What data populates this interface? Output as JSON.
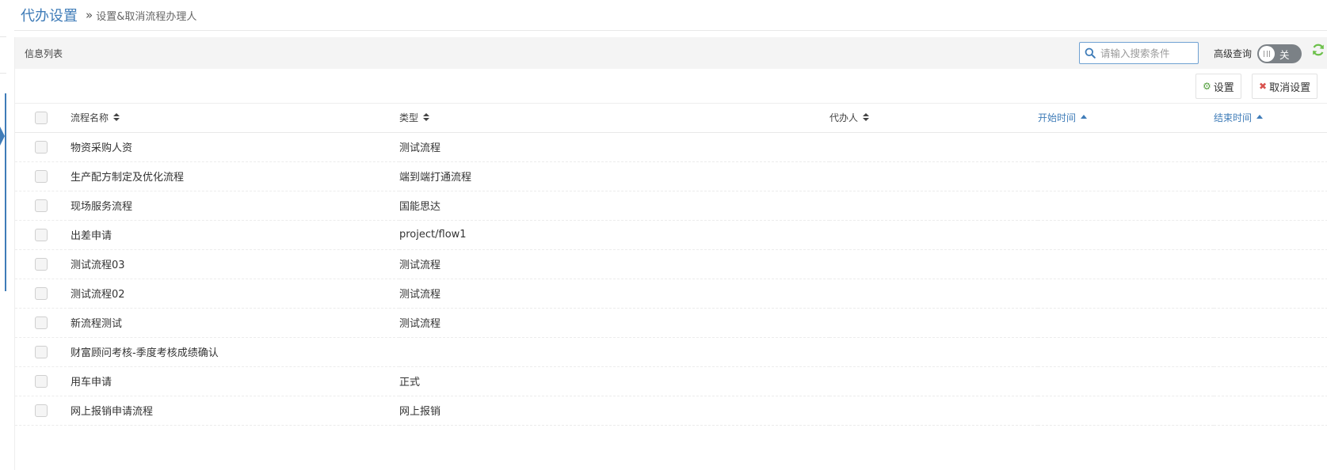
{
  "header": {
    "title": "代办设置",
    "breadcrumb_sep": "»",
    "breadcrumb": "设置&取消流程办理人"
  },
  "panel": {
    "title": "信息列表",
    "search": {
      "placeholder": "请输入搜索条件"
    },
    "advanced_label": "高级查询",
    "toggle_text": "关"
  },
  "toolbar": {
    "set_label": "设置",
    "cancel_label": "取消设置"
  },
  "table": {
    "columns": [
      "流程名称",
      "类型",
      "代办人",
      "开始时间",
      "结束时间"
    ],
    "rows": [
      {
        "name": "物资采购人资",
        "type": "测试流程",
        "agent": "",
        "start": "",
        "end": ""
      },
      {
        "name": "生产配方制定及优化流程",
        "type": "端到端打通流程",
        "agent": "",
        "start": "",
        "end": ""
      },
      {
        "name": "现场服务流程",
        "type": "国能思达",
        "agent": "",
        "start": "",
        "end": ""
      },
      {
        "name": "出差申请",
        "type": "project/flow1",
        "agent": "",
        "start": "",
        "end": ""
      },
      {
        "name": "测试流程03",
        "type": "测试流程",
        "agent": "",
        "start": "",
        "end": ""
      },
      {
        "name": "测试流程02",
        "type": "测试流程",
        "agent": "",
        "start": "",
        "end": ""
      },
      {
        "name": "新流程测试",
        "type": "测试流程",
        "agent": "",
        "start": "",
        "end": ""
      },
      {
        "name": "财富顾问考核-季度考核成绩确认",
        "type": "",
        "agent": "",
        "start": "",
        "end": ""
      },
      {
        "name": "用车申请",
        "type": "正式",
        "agent": "",
        "start": "",
        "end": ""
      },
      {
        "name": "网上报销申请流程",
        "type": "网上报销",
        "agent": "",
        "start": "",
        "end": ""
      }
    ]
  },
  "colors": {
    "accent": "#3f7cb8",
    "set_icon": "#56a040",
    "cancel_icon": "#d9534f",
    "refresh_icon": "#6cc04a"
  },
  "icons": {
    "search": "search-icon",
    "refresh": "refresh-icon",
    "set": "gear-icon",
    "cancel": "close-icon"
  }
}
